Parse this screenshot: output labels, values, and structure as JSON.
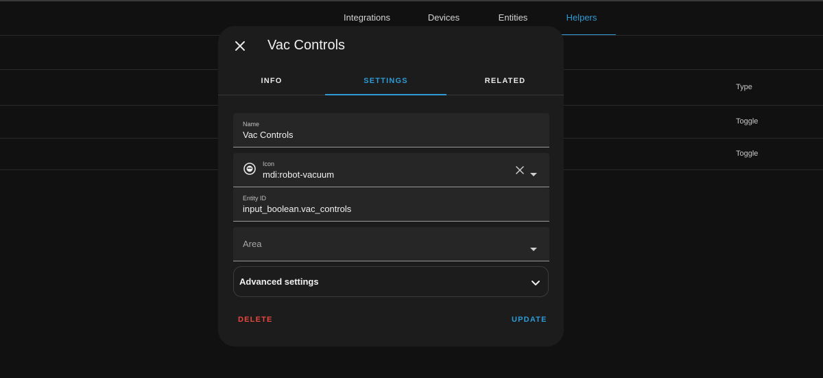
{
  "nav": {
    "tabs": [
      {
        "label": "Integrations"
      },
      {
        "label": "Devices"
      },
      {
        "label": "Entities"
      },
      {
        "label": "Helpers"
      }
    ],
    "active": "Helpers"
  },
  "table": {
    "type_header": "Type",
    "rows": [
      {
        "type": "Toggle"
      },
      {
        "type": "Toggle"
      }
    ]
  },
  "dialog": {
    "title": "Vac Controls",
    "tabs": [
      {
        "label": "INFO"
      },
      {
        "label": "SETTINGS"
      },
      {
        "label": "RELATED"
      }
    ],
    "active_tab": "SETTINGS",
    "fields": {
      "name": {
        "label": "Name",
        "value": "Vac Controls"
      },
      "icon": {
        "label": "Icon",
        "value": "mdi:robot-vacuum"
      },
      "entity_id": {
        "label": "Entity ID",
        "value": "input_boolean.vac_controls"
      },
      "area": {
        "placeholder": "Area"
      }
    },
    "advanced_label": "Advanced settings",
    "delete_label": "DELETE",
    "update_label": "UPDATE"
  },
  "colors": {
    "accent": "#2f9bd6",
    "danger": "#e8473d",
    "dialog_bg": "#1c1c1c",
    "field_bg": "#262626"
  },
  "icons": {
    "close": "close-icon",
    "field_icon": "robot-vacuum-icon",
    "clear": "clear-icon",
    "dropdown": "caret-down-icon",
    "expand": "chevron-down-icon"
  }
}
